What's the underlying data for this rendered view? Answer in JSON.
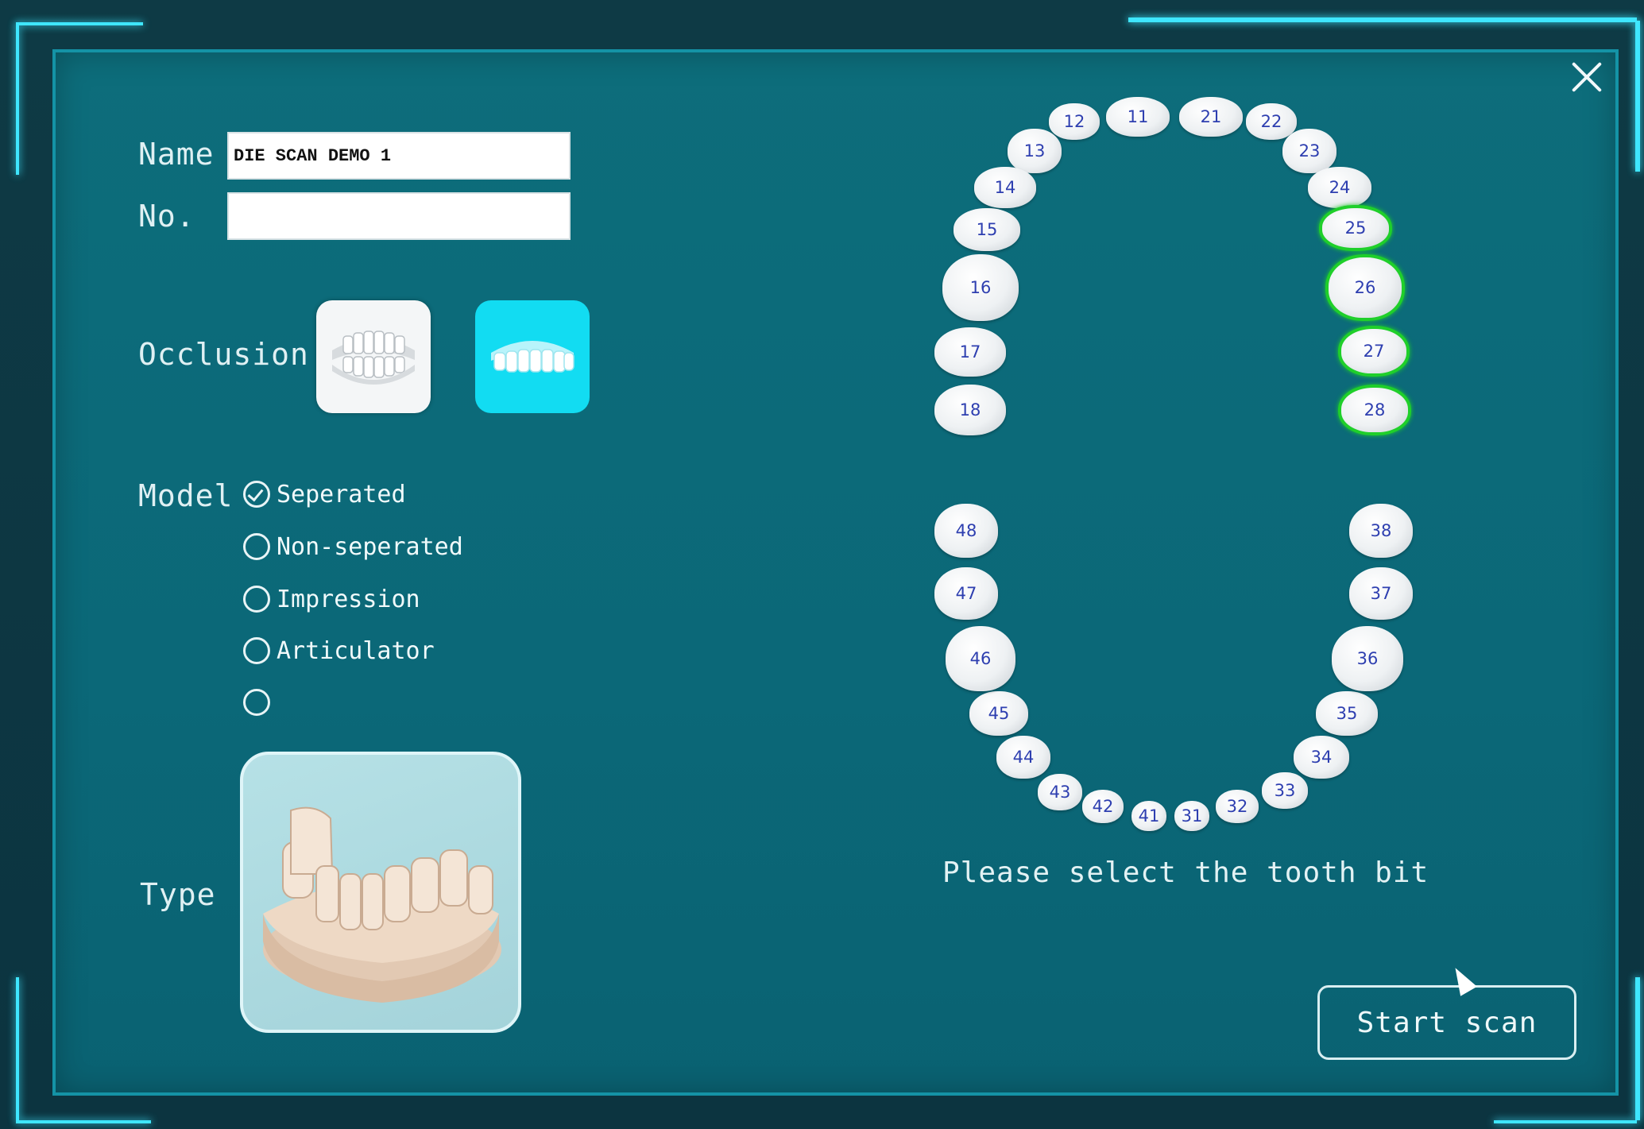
{
  "form": {
    "name_label": "Name",
    "name_value": "DIE SCAN DEMO 1",
    "no_label": "No.",
    "no_value": "",
    "occlusion_label": "Occlusion",
    "model_label": "Model",
    "type_label": "Type"
  },
  "occlusion": {
    "options": [
      {
        "icon": "full-jaw-occlusion-icon",
        "selected": false
      },
      {
        "icon": "upper-jaw-occlusion-icon",
        "selected": true
      }
    ]
  },
  "model": {
    "options": [
      {
        "label": "Seperated",
        "selected": true
      },
      {
        "label": "Non-seperated",
        "selected": false
      },
      {
        "label": "Impression",
        "selected": false
      },
      {
        "label": "Articulator",
        "selected": false
      },
      {
        "label": "",
        "selected": false
      }
    ]
  },
  "type": {
    "image": "plaster-dental-model-image"
  },
  "teeth": {
    "upper": [
      "11",
      "12",
      "13",
      "14",
      "15",
      "16",
      "17",
      "18",
      "21",
      "22",
      "23",
      "24",
      "25",
      "26",
      "27",
      "28"
    ],
    "lower": [
      "31",
      "32",
      "33",
      "34",
      "35",
      "36",
      "37",
      "38",
      "41",
      "42",
      "43",
      "44",
      "45",
      "46",
      "47",
      "48"
    ],
    "selected": [
      "25",
      "26",
      "27",
      "28"
    ]
  },
  "hint": "Please select the tooth bit",
  "start_button": "Start scan",
  "colors": {
    "accent": "#3fe6ff",
    "selected_tooth": "#1fcf2a",
    "panel": "#0b6878"
  }
}
